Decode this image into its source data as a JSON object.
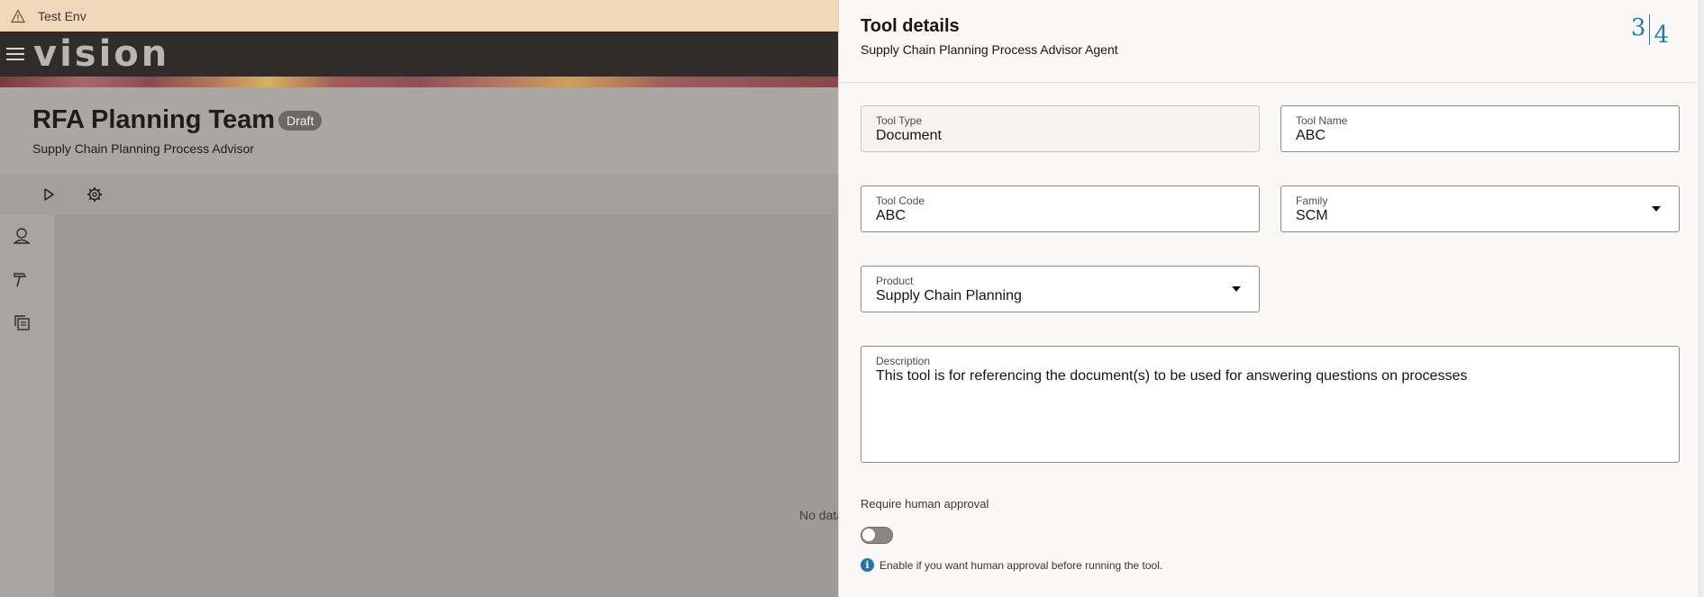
{
  "env_bar": {
    "label": "Test Env"
  },
  "brand": {
    "logo_text": "vision"
  },
  "page": {
    "title": "RFA Planning Team",
    "status_badge": "Draft",
    "subtitle": "Supply Chain Planning Process Advisor"
  },
  "toolbar": {
    "run_icon": "play-icon",
    "settings_icon": "gear-icon"
  },
  "side_rail": {
    "icons": [
      "agent-icon",
      "hammer-icon",
      "copy-icon"
    ]
  },
  "canvas": {
    "empty_text": "No data"
  },
  "drawer": {
    "title": "Tool details",
    "subtitle": "Supply Chain Planning Process Advisor Agent",
    "corner_mark": {
      "left": "3",
      "right": "4"
    },
    "fields": {
      "tool_type": {
        "label": "Tool Type",
        "value": "Document"
      },
      "tool_name": {
        "label": "Tool Name",
        "value": "ABC"
      },
      "tool_code": {
        "label": "Tool Code",
        "value": "ABC"
      },
      "family": {
        "label": "Family",
        "value": "SCM"
      },
      "product": {
        "label": "Product",
        "value": "Supply Chain Planning"
      },
      "description": {
        "label": "Description",
        "value": "This tool is for referencing the document(s) to be used for answering questions on processes"
      }
    },
    "approval": {
      "label": "Require human approval",
      "enabled": false,
      "help_text": "Enable if you want human approval before running the tool."
    }
  },
  "colors": {
    "accent": "#227ea8",
    "info": "#2672a6",
    "brand_bar": "#2f2c29",
    "env_bar": "#f1d7b8"
  }
}
